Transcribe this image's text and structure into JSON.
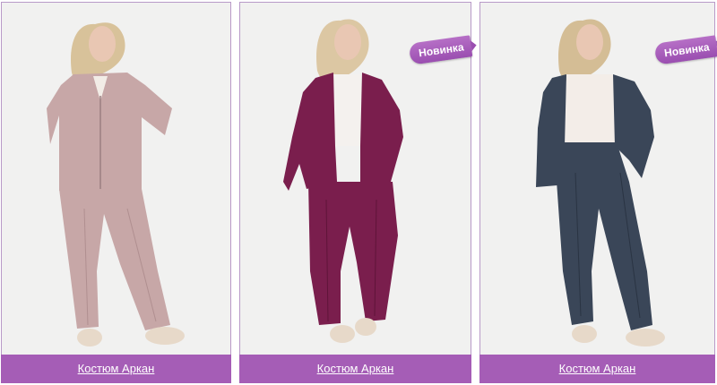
{
  "products": [
    {
      "name": "Костюм Аркан",
      "badge": "",
      "image_alt": "woman in dusty-pink fleece tracksuit",
      "color": "#c7a7a7"
    },
    {
      "name": "Костюм Аркан",
      "badge": "Новинка",
      "image_alt": "woman in plum fleece tracksuit",
      "color": "#7a1e4d"
    },
    {
      "name": "Костюм Аркан",
      "badge": "Новинка",
      "image_alt": "woman in navy fleece tracksuit",
      "color": "#3a4658"
    }
  ],
  "theme": {
    "caption_bg": "#a55db6",
    "badge_bg": "#a35ab8",
    "photo_bg": "#f1f1f0"
  }
}
